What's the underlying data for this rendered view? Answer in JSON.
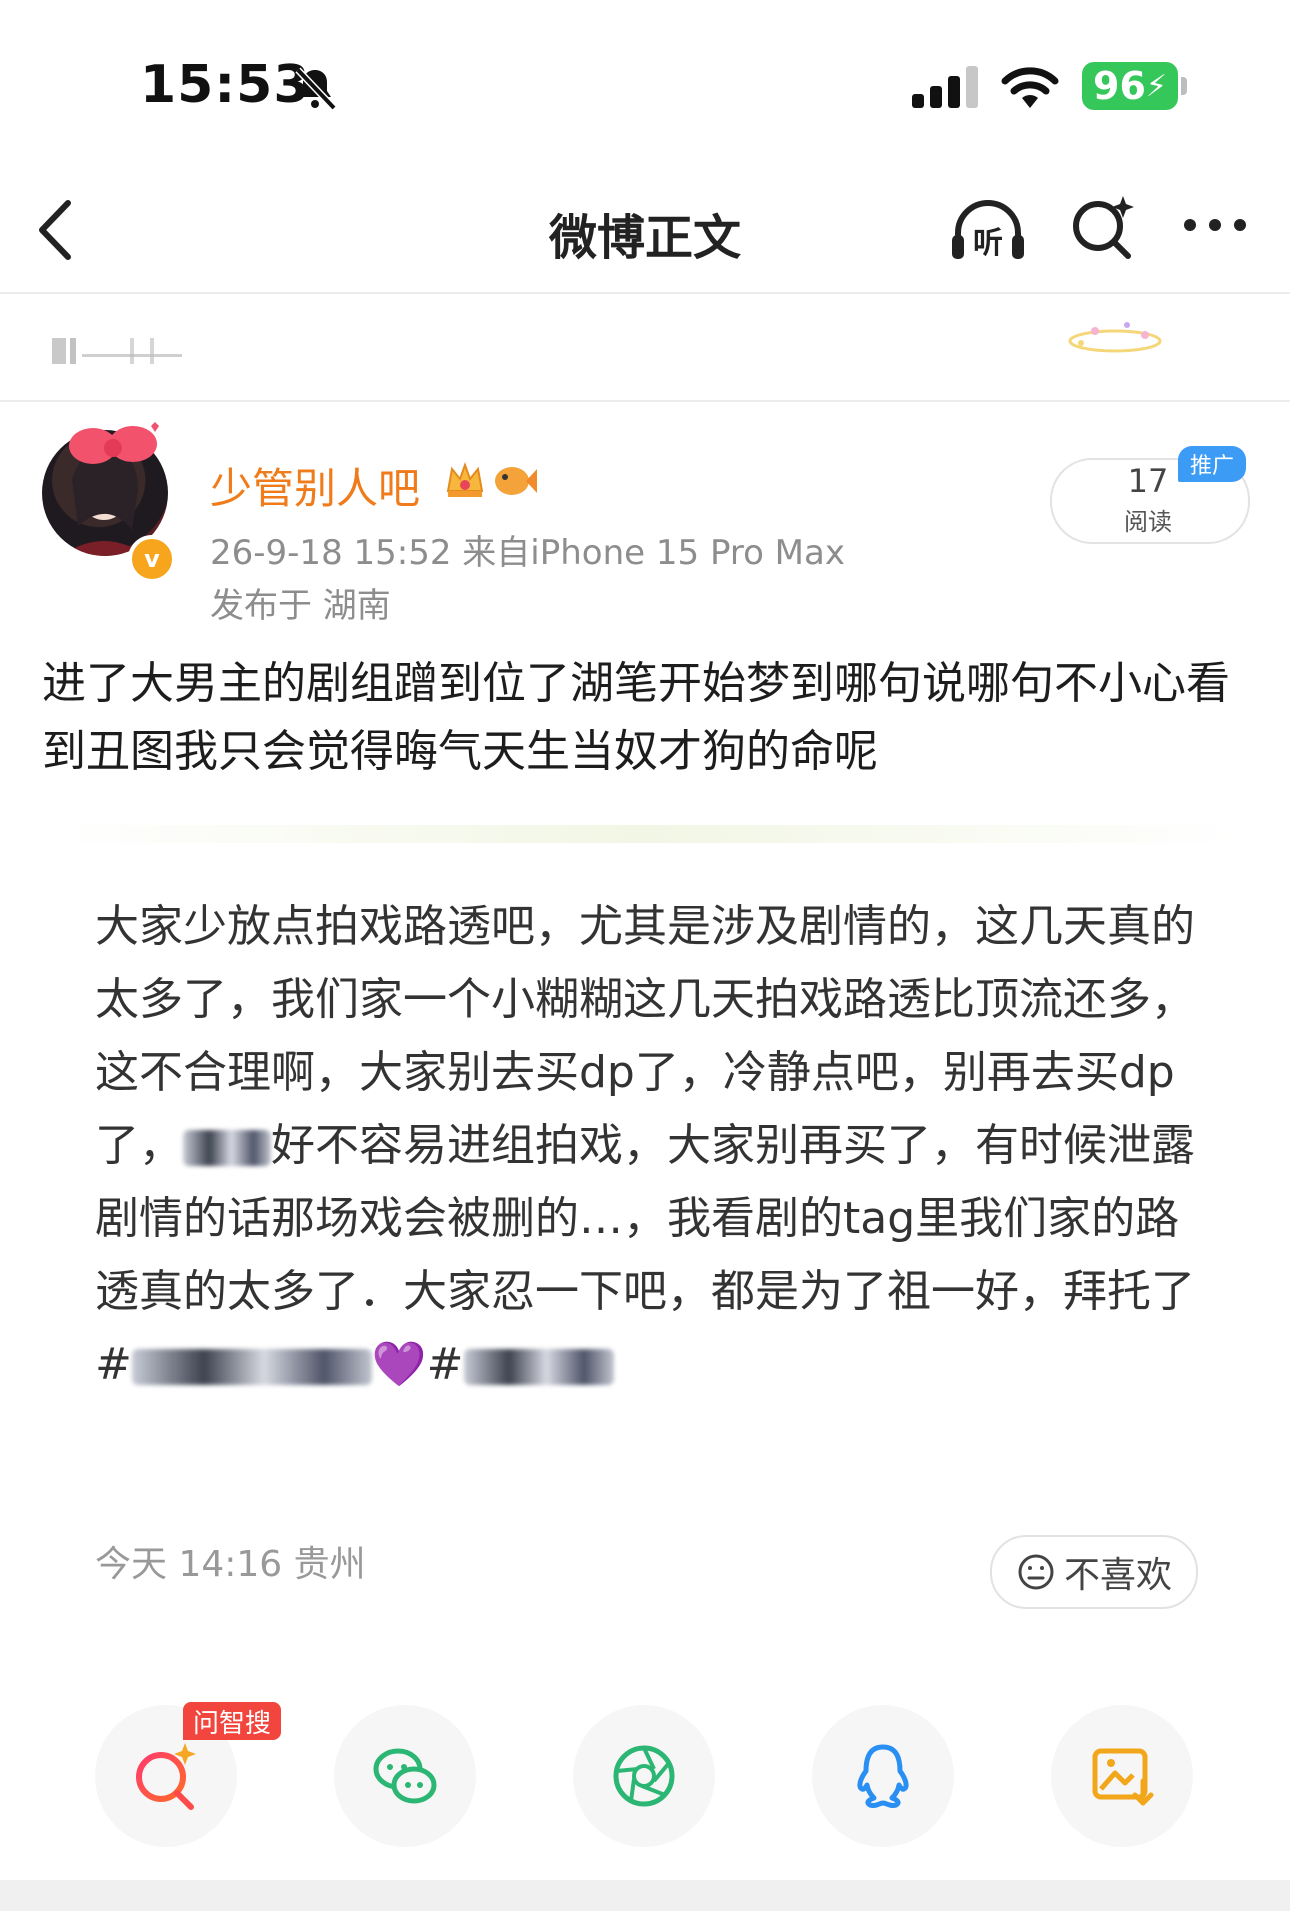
{
  "status_bar": {
    "time": "15:53",
    "battery": "96"
  },
  "nav": {
    "title": "微博正文",
    "listen_label": "听"
  },
  "post": {
    "username": "少管别人吧",
    "avatar_badge": "v",
    "meta": "26-9-18 15:52  来自iPhone 15 Pro Max",
    "location": "发布于 湖南",
    "reads_count": "17",
    "reads_label": "阅读",
    "promo_badge": "推广",
    "text": "进了大男主的剧组蹭到位了湖笔开始梦到哪句说哪句不小心看到丑图我只会觉得晦气天生当奴才狗的命呢"
  },
  "embed": {
    "body_before": "大家少放点拍戏路透吧，尤其是涉及剧情的，这几天真的太多了，我们家一个小糊糊这几天拍戏路透比顶流还多，这不合理啊，大家别去买dp了，冷静点吧，别再去买dp了，",
    "body_middle": "好不容易进组拍戏，大家别再买了，有时候泄露剧情的话那场戏会被删的…，我看剧的tag里我们家的路透真的太多了．大家忍一下吧，都是为了祖一好，拜托了#",
    "heart": "💜",
    "hash": "#",
    "meta": "今天 14:16 贵州",
    "dislike_label": "不喜欢"
  },
  "share": {
    "ai_badge": "问智搜"
  },
  "colors": {
    "accent_orange": "#f07b1a",
    "promo_blue": "#3b9bf5",
    "battery_green": "#35c759",
    "ai_red": "#f2453d"
  }
}
